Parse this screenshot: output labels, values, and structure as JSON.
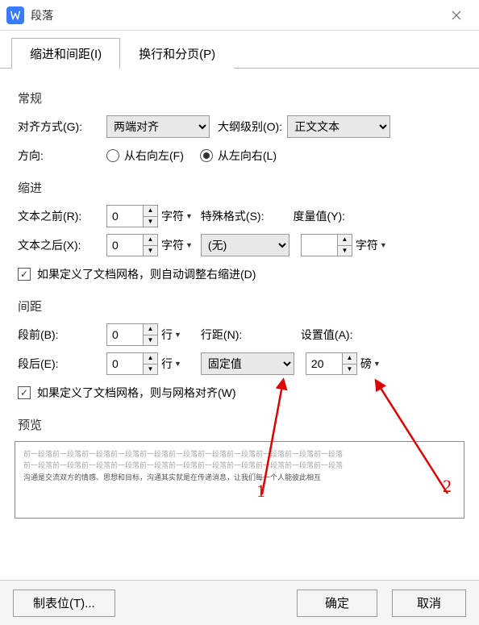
{
  "window": {
    "title": "段落"
  },
  "tabs": {
    "indent_spacing": "缩进和间距(I)",
    "line_page_break": "换行和分页(P)"
  },
  "general": {
    "title": "常规",
    "alignment_label": "对齐方式(G):",
    "alignment_value": "两端对齐",
    "outline_label": "大纲级别(O):",
    "outline_value": "正文文本",
    "direction_label": "方向:",
    "rtl": "从右向左(F)",
    "ltr": "从左向右(L)"
  },
  "indent": {
    "title": "缩进",
    "before_label": "文本之前(R):",
    "before_value": "0",
    "after_label": "文本之后(X):",
    "after_value": "0",
    "unit_char": "字符",
    "special_label": "特殊格式(S):",
    "special_value": "(无)",
    "measure_label": "度量值(Y):",
    "measure_value": "",
    "checkbox": "如果定义了文档网格，则自动调整右缩进(D)"
  },
  "spacing": {
    "title": "间距",
    "before_label": "段前(B):",
    "before_value": "0",
    "after_label": "段后(E):",
    "after_value": "0",
    "unit_line": "行",
    "line_spacing_label": "行距(N):",
    "line_spacing_value": "固定值",
    "set_value_label": "设置值(A):",
    "set_value": "20",
    "unit_pt": "磅",
    "checkbox": "如果定义了文档网格，则与网格对齐(W)"
  },
  "preview": {
    "title": "预览",
    "filler1": "前一段落前一段落前一段落前一段落前一段落前一段落前一段落前一段落前一段落前一段落前一段落",
    "filler2": "前一段落前一段落前一段落前一段落前一段落前一段落前一段落前一段落前一段落前一段落前一段落",
    "main": "沟通是交流双方的情感、思想和目标，沟通其实就是在传递消息，让我们每一个人能彼此相互"
  },
  "footer": {
    "tabstops": "制表位(T)...",
    "ok": "确定",
    "cancel": "取消"
  },
  "annotations": {
    "n1": "1",
    "n2": "2"
  }
}
